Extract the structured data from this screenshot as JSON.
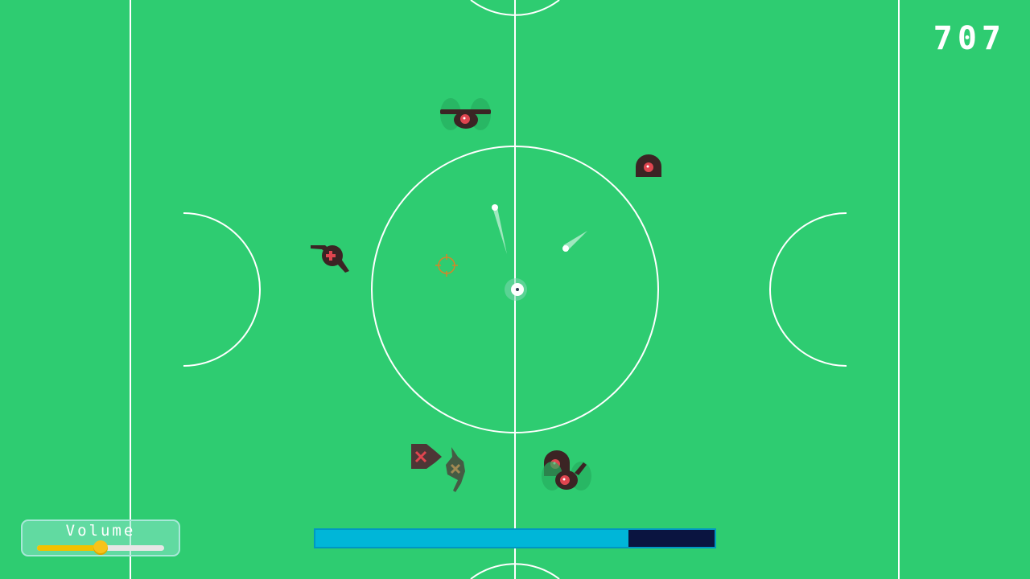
{
  "hud": {
    "score": "707",
    "volume": {
      "label": "Volume",
      "level": 0.5
    },
    "health": {
      "fraction": 0.785
    }
  },
  "colors": {
    "field": "#2ecc71",
    "lines": "#ffffff",
    "enemy_body": "#3b2424",
    "enemy_eye": "#e0454f",
    "health_fill": "#00b6d8",
    "health_empty": "#0a1440",
    "volume_fill": "#f2c200",
    "crosshair": "#e67e22"
  },
  "entities": {
    "player": "player-ship",
    "crosshair": "crosshair-icon",
    "enemies": [
      "drone-enemy",
      "dome-turret-enemy",
      "cannon-enemy",
      "wreck-enemy",
      "dome-turret-enemy",
      "drone-enemy"
    ]
  }
}
